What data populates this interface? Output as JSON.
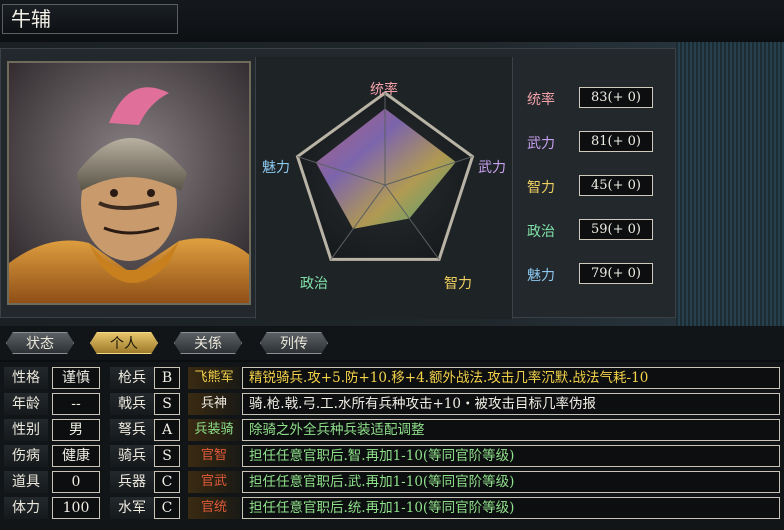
{
  "character": {
    "name": "牛辅"
  },
  "radar": {
    "labels": {
      "top": "统率",
      "right": "武力",
      "bottom_right": "智力",
      "bottom_left": "政治",
      "left": "魅力"
    },
    "values": {
      "tongshuai": 83,
      "wuli": 81,
      "zhili": 45,
      "zhengzhi": 59,
      "meili": 79
    },
    "max": 100
  },
  "stats": [
    {
      "label": "统率",
      "value": "83(+ 0)",
      "color": "#f2a0a8"
    },
    {
      "label": "武力",
      "value": "81(+ 0)",
      "color": "#c8a0f0"
    },
    {
      "label": "智力",
      "value": "45(+ 0)",
      "color": "#f0d060"
    },
    {
      "label": "政治",
      "value": "59(+ 0)",
      "color": "#80e0a8"
    },
    {
      "label": "魅力",
      "value": "79(+ 0)",
      "color": "#8cc8f0"
    }
  ],
  "tabs": [
    {
      "label": "状态",
      "active": false
    },
    {
      "label": "个人",
      "active": true
    },
    {
      "label": "关係",
      "active": false
    },
    {
      "label": "列传",
      "active": false
    }
  ],
  "attributes": [
    {
      "label": "性格",
      "value": "谨慎"
    },
    {
      "label": "年龄",
      "value": "--"
    },
    {
      "label": "性别",
      "value": "男"
    },
    {
      "label": "伤病",
      "value": "健康"
    },
    {
      "label": "道具",
      "value": "0"
    },
    {
      "label": "体力",
      "value": "100"
    }
  ],
  "troops": [
    {
      "label": "枪兵",
      "grade": "B"
    },
    {
      "label": "戟兵",
      "grade": "S"
    },
    {
      "label": "弩兵",
      "grade": "A"
    },
    {
      "label": "骑兵",
      "grade": "S"
    },
    {
      "label": "兵器",
      "grade": "C"
    },
    {
      "label": "水军",
      "grade": "C"
    }
  ],
  "skills": [
    {
      "name": "飞熊军",
      "name_color": "#f4d24a",
      "desc": "精锐骑兵.攻+5.防+10.移+4.额外战法.攻击几率沉默.战法气耗-10",
      "desc_color": "#f4d24a"
    },
    {
      "name": "兵神",
      "name_color": "#f0ede4",
      "desc": "骑.枪.戟.弓.工.水所有兵种攻击+10・被攻击目标几率伪报",
      "desc_color": "#f0ede4"
    },
    {
      "name": "兵装骑",
      "name_color": "#8fe08a",
      "desc": "除骑之外全兵种兵装适配调整",
      "desc_color": "#8fe08a"
    },
    {
      "name": "官智",
      "name_color": "#e05a3a",
      "desc": "担任任意官职后.智.再加1-10(等同官阶等级)",
      "desc_color": "#8fe08a"
    },
    {
      "name": "官武",
      "name_color": "#e05a3a",
      "desc": "担任任意官职后.武.再加1-10(等同官阶等级)",
      "desc_color": "#8fe08a"
    },
    {
      "name": "官统",
      "name_color": "#e05a3a",
      "desc": "担任任意官职后.统.再加1-10(等同官阶等级)",
      "desc_color": "#8fe08a"
    }
  ]
}
